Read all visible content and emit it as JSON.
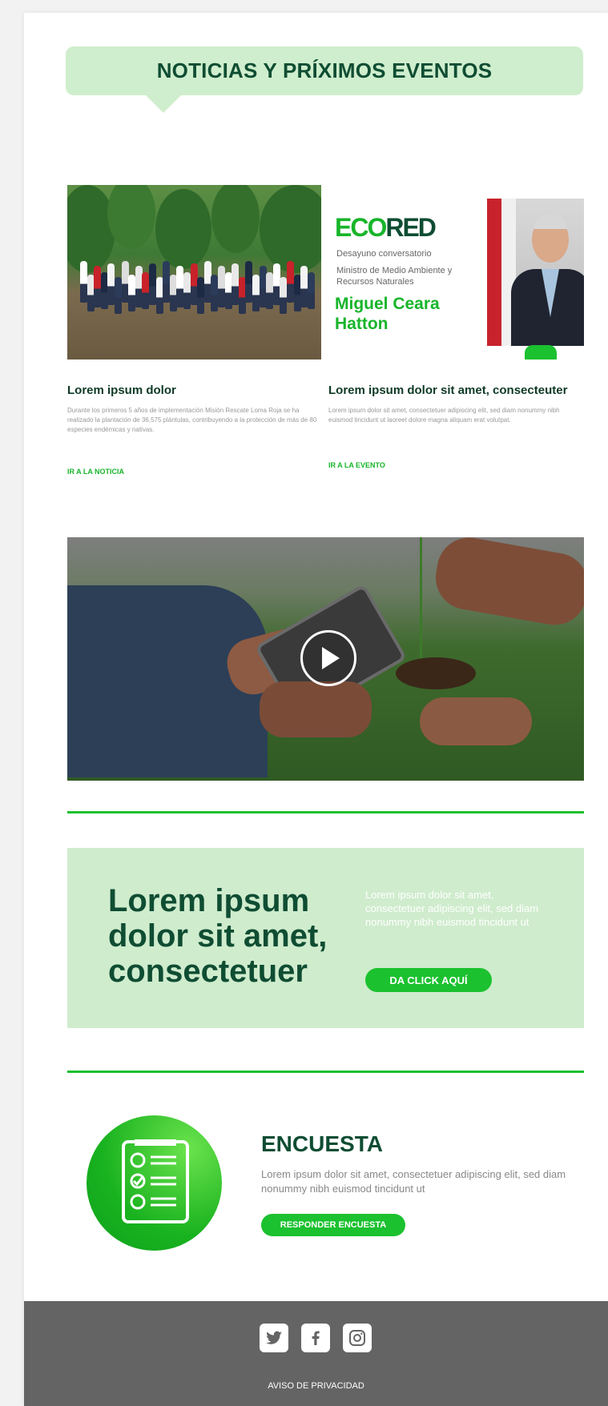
{
  "header": {
    "title": "NOTICIAS Y PRÍXIMOS EVENTOS"
  },
  "ecored": {
    "logo_green": "ECO",
    "logo_dark": "RED",
    "subtitle": "Desayuno conversatorio",
    "ministry": "Ministro de Medio Ambiente y Recursos Naturales",
    "name": "Miguel Ceara Hatton"
  },
  "articles": [
    {
      "title": "Lorem ipsum dolor",
      "text": "Durante los primeros 5 años de implementación Misión Rescate Loma Roja se ha realizado la plantación de 36,575 plántulas, contribuyendo a la protección de más de 80 especies endémicas y nativas.",
      "link": "IR A LA NOTICIA"
    },
    {
      "title": "Lorem ipsum dolor sit amet, consecteuter",
      "text": "Lorem ipsum dolor sit amet, consectetuer adipiscing elit, sed diam nonummy nibh euismod tincidunt ut laoreet dolore magna aliquam erat volutpat.",
      "link": "IR A LA EVENTO"
    }
  ],
  "cta": {
    "headline": "Lorem ipsum dolor sit amet, consectetuer",
    "text": "Lorem ipsum dolor sit amet, consectetuer adipiscing elit, sed diam nonummy nibh euismod tincidunt ut",
    "button": "DA CLICK AQUÍ"
  },
  "survey": {
    "title": "ENCUESTA",
    "text": "Lorem ipsum dolor sit amet, consectetuer adipiscing elit, sed diam nonummy nibh euismod tincidunt ut",
    "button": "RESPONDER ENCUESTA"
  },
  "footer": {
    "privacy": "AVISO DE PRIVACIDAD",
    "icons": [
      "twitter-icon",
      "facebook-icon",
      "instagram-icon"
    ]
  },
  "colors": {
    "accent": "#1bc12f",
    "dark_green": "#0f4d33",
    "light_green": "#cfeecd",
    "footer_bg": "#646464"
  }
}
